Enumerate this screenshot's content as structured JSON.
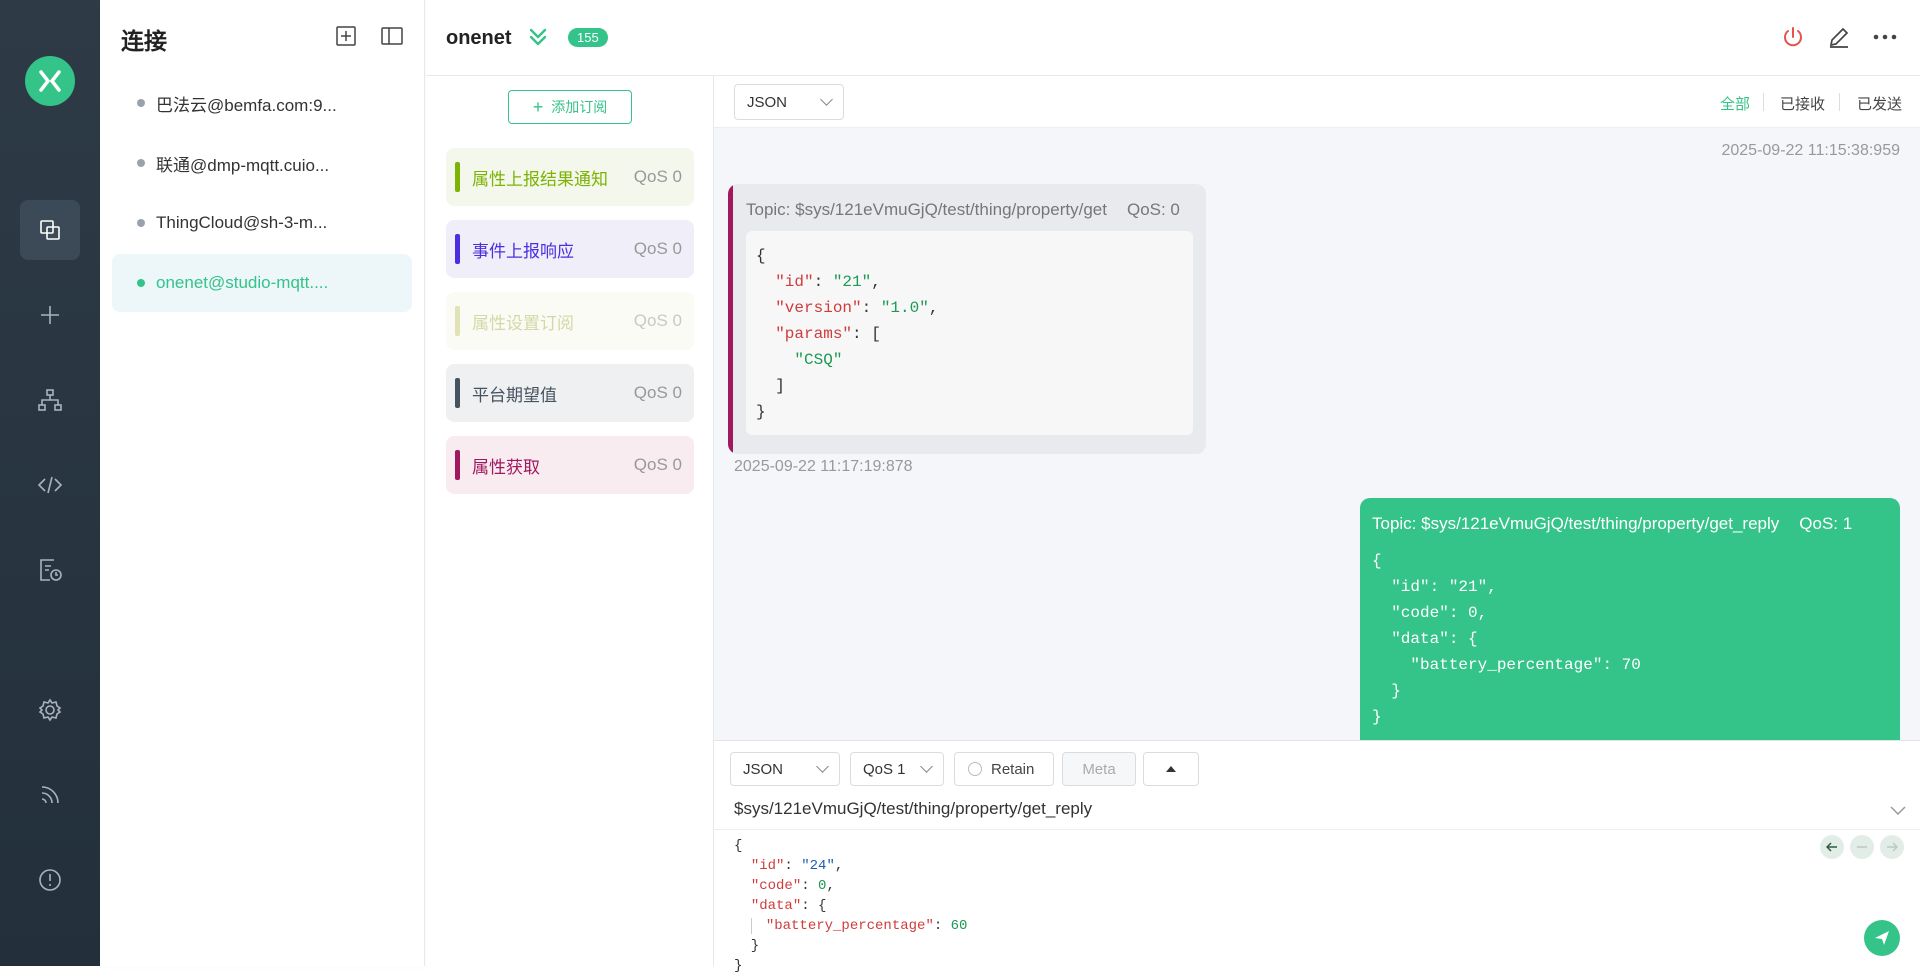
{
  "sidebar": {
    "nav_icons": [
      "logo-icon",
      "connections-icon",
      "new-connection-icon",
      "topology-icon",
      "script-icon",
      "log-icon",
      "settings-icon",
      "subscribe-feed-icon",
      "about-icon"
    ]
  },
  "connections_panel": {
    "title": "连接",
    "items": [
      {
        "label": "巴法云@bemfa.com:9...",
        "active": false
      },
      {
        "label": "联通@dmp-mqtt.cuio...",
        "active": false
      },
      {
        "label": "ThingCloud@sh-3-m...",
        "active": false
      },
      {
        "label": "onenet@studio-mqtt....",
        "active": true
      }
    ]
  },
  "header": {
    "connection_name": "onenet",
    "message_count": "155"
  },
  "topics_panel": {
    "add_button_label": "添加订阅",
    "items": [
      {
        "label": "属性上报结果通知",
        "qos": "QoS 0",
        "color": "#7cb305",
        "bg": "#f4f7ec",
        "text_color": "#7cb305"
      },
      {
        "label": "事件上报响应",
        "qos": "QoS 0",
        "color": "#4a2ee0",
        "bg": "#f0eef9",
        "text_color": "#4a2ee0"
      },
      {
        "label": "属性设置订阅",
        "qos": "QoS 0",
        "color": "#dfe3b6",
        "bg": "#fbfbf5",
        "text_color": "#d4d8a6"
      },
      {
        "label": "平台期望值",
        "qos": "QoS 0",
        "color": "#46525e",
        "bg": "#eff0f2",
        "text_color": "#46525e"
      },
      {
        "label": "属性获取",
        "qos": "QoS 0",
        "color": "#a2185e",
        "bg": "#f8ecf1",
        "text_color": "#a2185e"
      }
    ]
  },
  "messages": {
    "format": "JSON",
    "filters": {
      "all": "全部",
      "received": "已接收",
      "sent": "已发送"
    },
    "timestamp_top": "2025-09-22 11:15:38:959",
    "received": {
      "topic": "Topic: $sys/121eVmuGjQ/test/thing/property/get",
      "qos": "QoS: 0",
      "timestamp": "2025-09-22 11:17:19:878",
      "payload": {
        "id": "\"21\"",
        "version": "\"1.0\"",
        "params_item": "\"CSQ\""
      }
    },
    "sent": {
      "topic": "Topic: $sys/121eVmuGjQ/test/thing/property/get_reply",
      "qos": "QoS: 1",
      "payload": {
        "id": "\"21\"",
        "code": "0",
        "battery_percentage": "70"
      }
    }
  },
  "compose": {
    "format": "JSON",
    "qos": "QoS 1",
    "retain_label": "Retain",
    "meta_label": "Meta",
    "topic": "$sys/121eVmuGjQ/test/thing/property/get_reply",
    "payload": {
      "id": "\"24\"",
      "code": "0",
      "battery_percentage": "60"
    }
  },
  "colors": {
    "accent": "#34c388",
    "nav_bg": "#2e3b47",
    "power": "#e5534b"
  }
}
